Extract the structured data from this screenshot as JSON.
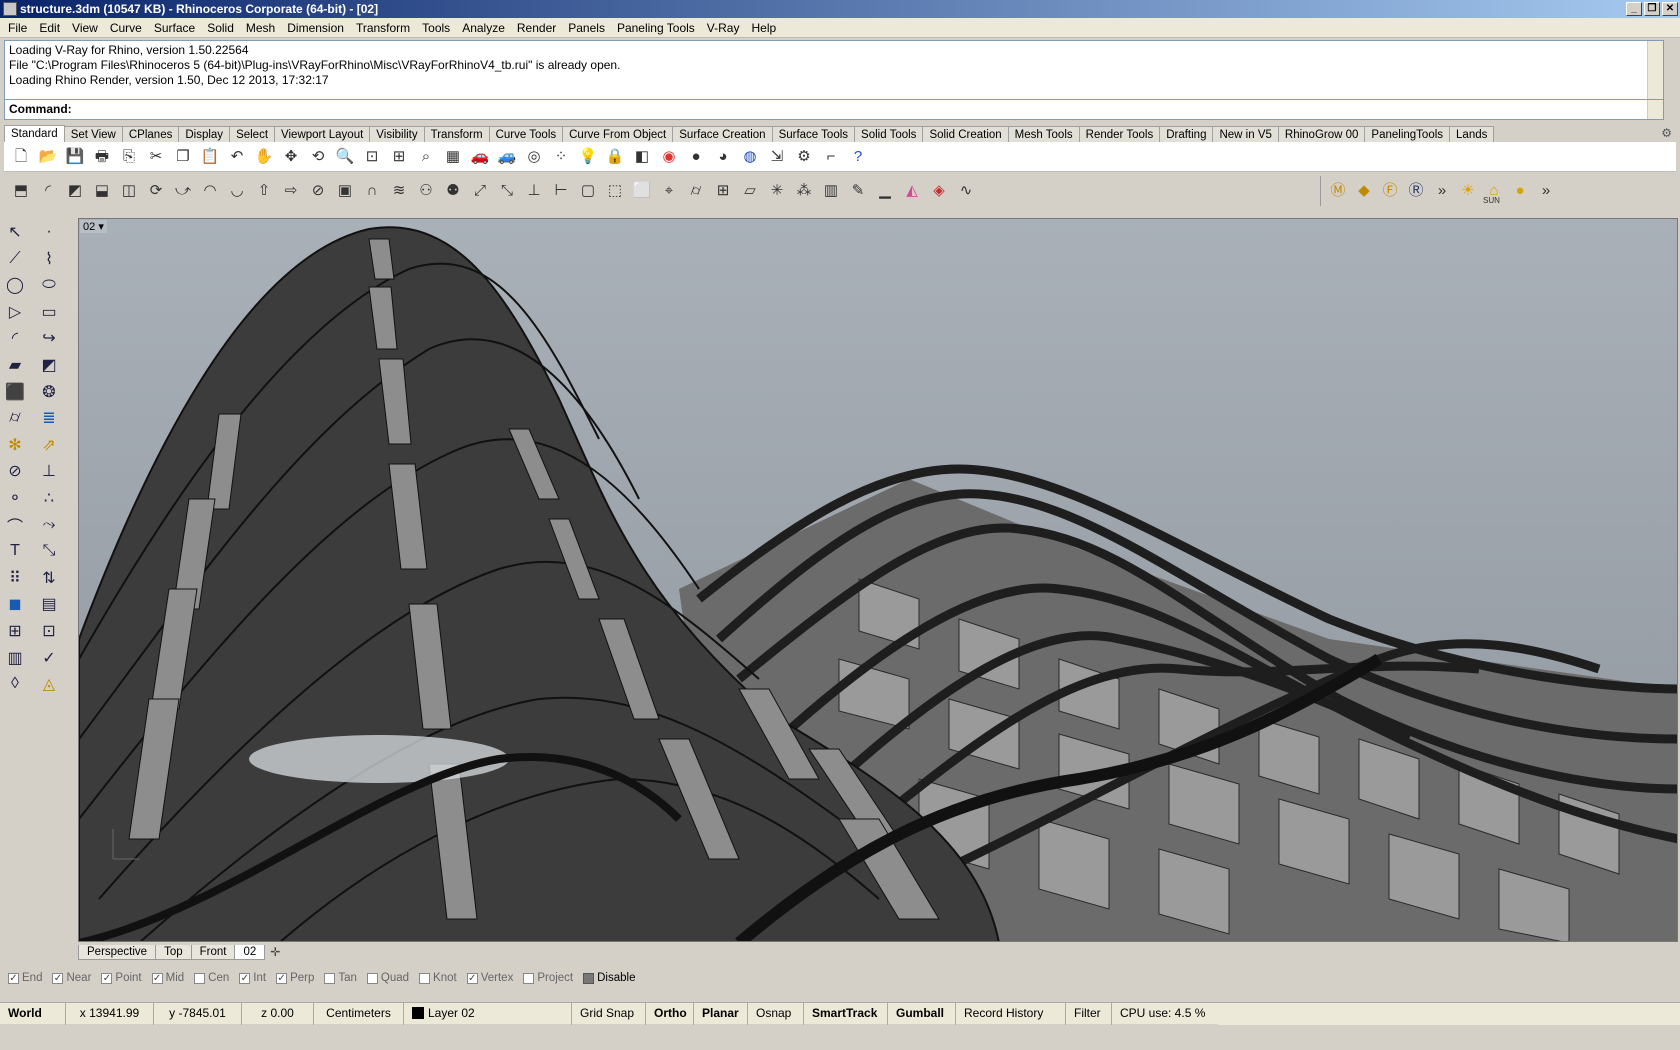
{
  "window": {
    "title": "structure.3dm (10547 KB) - Rhinoceros Corporate (64-bit) - [02]",
    "buttons": [
      "_",
      "❐",
      "✕"
    ]
  },
  "menu": [
    "File",
    "Edit",
    "View",
    "Curve",
    "Surface",
    "Solid",
    "Mesh",
    "Dimension",
    "Transform",
    "Tools",
    "Analyze",
    "Render",
    "Panels",
    "Paneling Tools",
    "V-Ray",
    "Help"
  ],
  "history": [
    "Loading V-Ray for Rhino, version 1.50.22564",
    "File \"C:\\Program Files\\Rhinoceros 5 (64-bit)\\Plug-ins\\VRayForRhino\\Misc\\VRayForRhinoV4_tb.rui\" is already open.",
    "Loading Rhino Render, version 1.50, Dec 12 2013, 17:32:17"
  ],
  "command": {
    "label": "Command:"
  },
  "toolbar_tabs": [
    "Standard",
    "Set View",
    "CPlanes",
    "Display",
    "Select",
    "Viewport Layout",
    "Visibility",
    "Transform",
    "Curve Tools",
    "Curve From Object",
    "Surface Creation",
    "Surface Tools",
    "Solid Tools",
    "Solid Creation",
    "Mesh Tools",
    "Render Tools",
    "Drafting",
    "New in V5",
    "RhinoGrow 00",
    "PanelingTools",
    "Lands"
  ],
  "toolbar_row1_icons": [
    "new-icon",
    "open-icon",
    "save-icon",
    "print-icon",
    "import-icon",
    "cut-icon",
    "copy-icon",
    "paste-icon",
    "undo-icon",
    "pan-hand-icon",
    "pan-icon",
    "rotate-view-icon",
    "zoom-icon",
    "zoom-window-icon",
    "zoom-extents-icon",
    "zoom-selected-icon",
    "viewport-grid-icon",
    "car-icon",
    "car-gray-icon",
    "cplane-icon",
    "select-points-icon",
    "light-icon",
    "lock-icon",
    "layer-icon",
    "color-wheel-icon",
    "sphere-shade-icon",
    "sphere-material-icon",
    "sphere-render-icon",
    "render-arrow-icon",
    "options-gear-icon",
    "dimension-icon",
    "help-icon"
  ],
  "toolbar_row2_icons": [
    "extrude-icon",
    "fillet-icon",
    "loft-icon",
    "solid-join-icon",
    "boolean-icon",
    "revolve-icon",
    "sweep-icon",
    "offset-icon",
    "shell-icon",
    "move-face-icon",
    "move-edge-icon",
    "split-icon",
    "box-edge-icon",
    "cap-icon",
    "wave-icon",
    "people-icon",
    "people2-icon",
    "fit-icon",
    "dec-icon",
    "analysis-icon",
    "dim-icon",
    "frame-icon",
    "frame-dots-icon",
    "dashed-box-icon",
    "target-icon",
    "cylinder-icon",
    "grid-icon",
    "plane-icon",
    "sparkle-icon",
    "scatter-icon",
    "book-icon",
    "edit-icon",
    "baseline-icon",
    "rainbow-icon",
    "cube-color-icon",
    "curve-wave-icon"
  ],
  "toolbar_right_icons": [
    "vray-m-icon",
    "vray-tag-icon",
    "vray-f-icon",
    "vray-r-icon",
    "more-icon",
    "sun-icon",
    "lamp-icon",
    "sphere-light-icon",
    "more2-icon"
  ],
  "toolbar_right_labels": {
    "sun": "SUN"
  },
  "left_tools": [
    "pointer-icon",
    "point-icon",
    "polyline-icon",
    "control-points-icon",
    "circle-icon",
    "ellipse-icon",
    "triangle-icon",
    "rectangle-icon",
    "arc-icon",
    "curve-edit-icon",
    "surface-icon",
    "surface-edit-icon",
    "box-icon",
    "boolean-union-icon",
    "cylinder-icon",
    "surface-tools-icon",
    "gear-cluster-icon",
    "arrow-burst-icon",
    "split-icon",
    "align-icon",
    "sphere-group-icon",
    "points-group-icon",
    "curve-icon",
    "curve-pick-icon",
    "text-icon",
    "scale-icon",
    "grid-group-icon",
    "edit-points-icon",
    "solid-block-icon",
    "hatch-icon",
    "array-icon",
    "measure-icon",
    "book-open-icon",
    "check-icon",
    "mesh-icon",
    "paint-icon"
  ],
  "viewport": {
    "label": "02",
    "dropdown": "▾"
  },
  "viewport_tabs": [
    "Perspective",
    "Top",
    "Front",
    "02"
  ],
  "viewport_tab_add": "✛",
  "osnaps": [
    {
      "label": "End",
      "checked": true
    },
    {
      "label": "Near",
      "checked": true
    },
    {
      "label": "Point",
      "checked": true
    },
    {
      "label": "Mid",
      "checked": true
    },
    {
      "label": "Cen",
      "checked": false
    },
    {
      "label": "Int",
      "checked": true
    },
    {
      "label": "Perp",
      "checked": true
    },
    {
      "label": "Tan",
      "checked": false
    },
    {
      "label": "Quad",
      "checked": false
    },
    {
      "label": "Knot",
      "checked": false
    },
    {
      "label": "Vertex",
      "checked": true
    },
    {
      "label": "Project",
      "checked": false
    },
    {
      "label": "Disable",
      "checked": false
    }
  ],
  "status": {
    "world": "World",
    "x": "x 13941.99",
    "y": "y -7845.01",
    "z": "z 0.00",
    "units": "Centimeters",
    "layer": "Layer 02",
    "grid_snap": "Grid Snap",
    "ortho": "Ortho",
    "planar": "Planar",
    "osnap": "Osnap",
    "smarttrack": "SmartTrack",
    "gumball": "Gumball",
    "record_history": "Record History",
    "filter": "Filter",
    "cpu": "CPU use: 4.5 %"
  },
  "colors": {
    "viewport_bg": "#9aa2ab",
    "title_start": "#0a246a",
    "title_end": "#a6caf0",
    "structure_dark": "#3c3c3c",
    "fins": "#8c8c8c"
  }
}
